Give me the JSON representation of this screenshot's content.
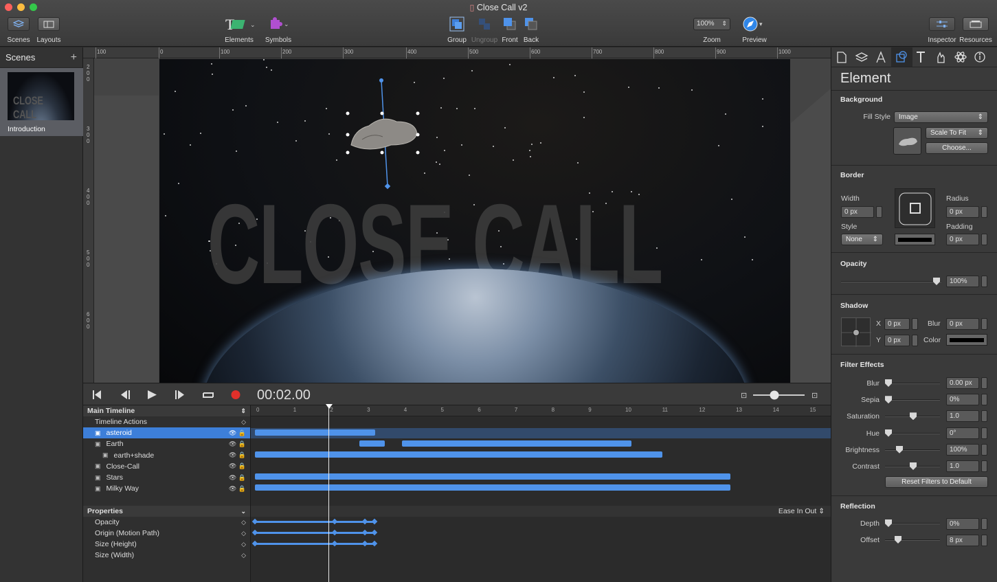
{
  "window": {
    "title": "Close Call v2"
  },
  "toolbar": {
    "scenes": "Scenes",
    "layouts": "Layouts",
    "elements": "Elements",
    "symbols": "Symbols",
    "group": "Group",
    "ungroup": "Ungroup",
    "front": "Front",
    "back": "Back",
    "zoom_value": "100%",
    "zoom": "Zoom",
    "preview": "Preview",
    "inspector": "Inspector",
    "resources": "Resources"
  },
  "scenes_panel": {
    "title": "Scenes",
    "add": "+",
    "items": [
      {
        "label": "Introduction",
        "thumb_text": "CLOSE CALL"
      }
    ]
  },
  "ruler": {
    "h": [
      "100",
      "0",
      "100",
      "200",
      "300",
      "400",
      "500",
      "600",
      "700",
      "800",
      "900",
      "1000"
    ],
    "v": [
      "2\n0\n0",
      "3\n0\n0",
      "4\n0\n0",
      "5\n0\n0",
      "6\n0\n0"
    ]
  },
  "stage": {
    "headline": "CLOSE CALL"
  },
  "transport": {
    "timecode": "00:02.00"
  },
  "timeline": {
    "name": "Main Timeline",
    "ticks": [
      "0",
      "1",
      "2",
      "3",
      "4",
      "5",
      "6",
      "7",
      "8",
      "9",
      "10",
      "11",
      "12",
      "13",
      "14",
      "15"
    ],
    "rows": [
      {
        "label": "Timeline Actions",
        "indent": 1
      },
      {
        "label": "asteroid",
        "indent": 1,
        "selected": true
      },
      {
        "label": "Earth",
        "indent": 1
      },
      {
        "label": "earth+shade",
        "indent": 2
      },
      {
        "label": "Close-Call",
        "indent": 1
      },
      {
        "label": "Stars",
        "indent": 1
      },
      {
        "label": "Milky Way",
        "indent": 1
      }
    ],
    "properties_header": "Properties",
    "easing": "Ease In Out",
    "properties": [
      "Opacity",
      "Origin (Motion Path)",
      "Size (Height)",
      "Size (Width)"
    ]
  },
  "inspector": {
    "title": "Element",
    "background": {
      "heading": "Background",
      "fill_style_label": "Fill Style",
      "fill_style": "Image",
      "scale": "Scale To Fit",
      "choose": "Choose..."
    },
    "border": {
      "heading": "Border",
      "width_label": "Width",
      "width": "0 px",
      "style_label": "Style",
      "style": "None",
      "radius_label": "Radius",
      "radius": "0 px",
      "padding_label": "Padding",
      "padding": "0 px"
    },
    "opacity": {
      "heading": "Opacity",
      "value": "100%"
    },
    "shadow": {
      "heading": "Shadow",
      "x_label": "X",
      "x": "0 px",
      "y_label": "Y",
      "y": "0 px",
      "blur_label": "Blur",
      "blur": "0 px",
      "color_label": "Color"
    },
    "filters": {
      "heading": "Filter Effects",
      "items": [
        {
          "label": "Blur",
          "value": "0.00 px"
        },
        {
          "label": "Sepia",
          "value": "0%"
        },
        {
          "label": "Saturation",
          "value": "1.0"
        },
        {
          "label": "Hue",
          "value": "0°"
        },
        {
          "label": "Brightness",
          "value": "100%"
        },
        {
          "label": "Contrast",
          "value": "1.0"
        }
      ],
      "reset": "Reset Filters to Default"
    },
    "reflection": {
      "heading": "Reflection",
      "depth_label": "Depth",
      "depth": "0%",
      "offset_label": "Offset",
      "offset": "8 px"
    }
  },
  "colors": {
    "accent": "#3d7fd9",
    "bar": "#4f93ea",
    "record": "#e0302a"
  }
}
